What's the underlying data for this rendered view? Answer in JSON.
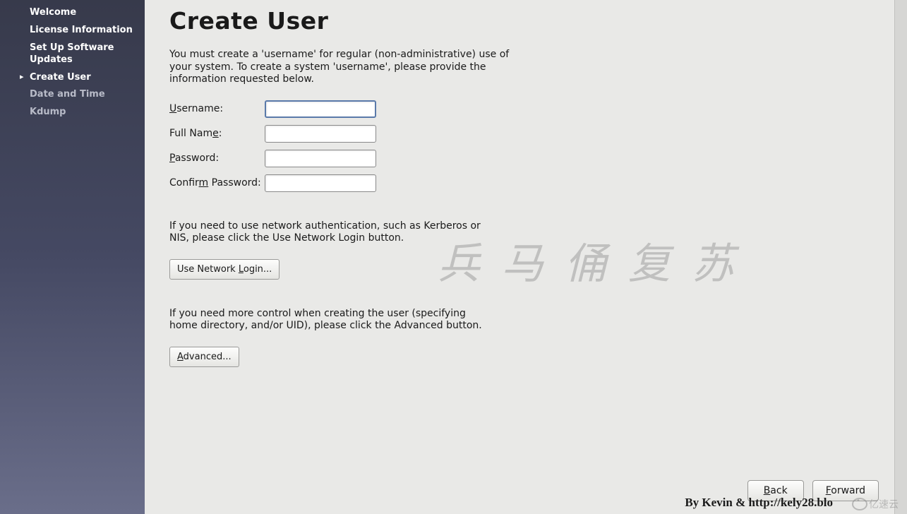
{
  "sidebar": {
    "items": [
      {
        "label": "Welcome",
        "state": "completed"
      },
      {
        "label": "License Information",
        "state": "completed"
      },
      {
        "label": "Set Up Software Updates",
        "state": "completed"
      },
      {
        "label": "Create User",
        "state": "active"
      },
      {
        "label": "Date and Time",
        "state": "pending"
      },
      {
        "label": "Kdump",
        "state": "pending"
      }
    ]
  },
  "page": {
    "title": "Create User",
    "intro": "You must create a 'username' for regular (non-administrative) use of your system.  To create a system 'username', please provide the information requested below."
  },
  "form": {
    "username": {
      "label_pre": "U",
      "label_post": "sername:",
      "value": ""
    },
    "fullname": {
      "label_pre": "Full Nam",
      "label_mid": "e",
      "label_post": ":",
      "value": ""
    },
    "password": {
      "label_pre": "P",
      "label_post": "assword:",
      "value": ""
    },
    "confirm": {
      "label_pre": "Confir",
      "label_mid": "m",
      "label_post": " Password:",
      "value": ""
    }
  },
  "network_login": {
    "text": "If you need to use network authentication, such as Kerberos or NIS, please click the Use Network Login button.",
    "button_pre": "Use Network ",
    "button_mid": "L",
    "button_post": "ogin..."
  },
  "advanced": {
    "text": "If you need more control when creating the user (specifying home directory, and/or UID), please click the Advanced button.",
    "button_pre": "A",
    "button_post": "dvanced..."
  },
  "footer": {
    "back_pre": "B",
    "back_post": "ack",
    "forward_pre": "F",
    "forward_post": "orward"
  },
  "watermark": {
    "chinese": "兵马俑复苏",
    "credit": "By Kevin & http://kely28.blo",
    "logo_text": "亿速云"
  }
}
